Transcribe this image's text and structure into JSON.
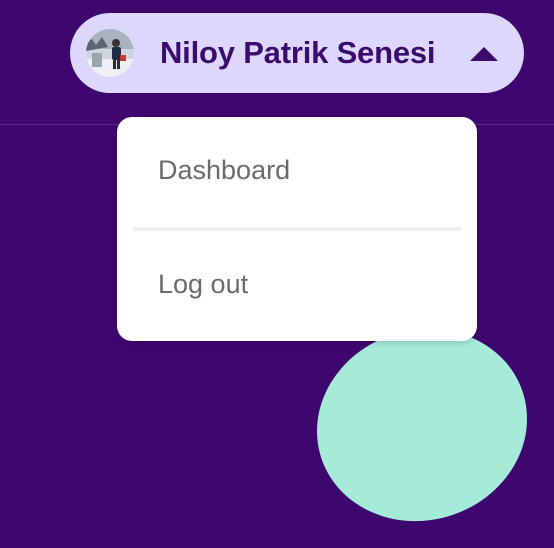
{
  "user": {
    "name": "Niloy Patrik Senesi",
    "avatar_icon": "user-avatar-photo",
    "menu_toggle_icon": "caret-up-icon"
  },
  "dropdown": {
    "items": [
      {
        "label": "Dashboard"
      },
      {
        "label": "Log out"
      }
    ]
  },
  "colors": {
    "background": "#3e0770",
    "pill": "#dcd7fb",
    "name_text": "#3b0b6e",
    "menu_bg": "#ffffff",
    "menu_text": "#6b6b6b",
    "accent_blob": "#a6ead8"
  }
}
